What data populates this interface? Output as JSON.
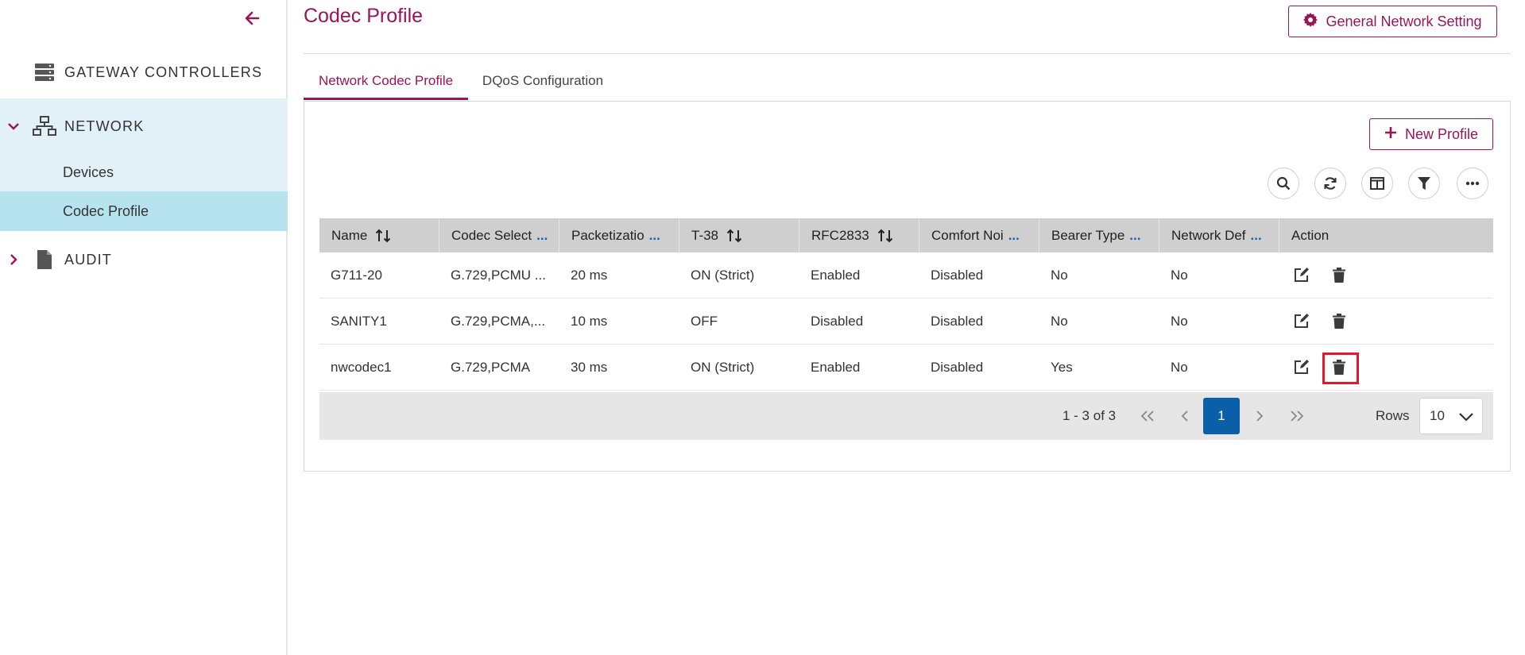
{
  "sidebar": {
    "collapse_icon": "arrow-left-icon",
    "items": [
      {
        "label": "GATEWAY CONTROLLERS",
        "icon": "server-icon"
      },
      {
        "label": "NETWORK",
        "icon": "network-icon",
        "expanded": true
      },
      {
        "label": "Devices"
      },
      {
        "label": "Codec Profile",
        "selected": true
      },
      {
        "label": "AUDIT",
        "icon": "document-icon",
        "expanded": false
      }
    ]
  },
  "header": {
    "title": "Codec Profile",
    "settings_button": "General Network Setting"
  },
  "tabs": [
    {
      "label": "Network Codec Profile",
      "active": true
    },
    {
      "label": "DQoS Configuration",
      "active": false
    }
  ],
  "toolbar": {
    "new_button": "New Profile",
    "icons": [
      "search-icon",
      "refresh-icon",
      "columns-icon",
      "filter-icon",
      "more-icon"
    ]
  },
  "table": {
    "columns": [
      {
        "label": "Name",
        "sortable": true
      },
      {
        "label": "Codec Select",
        "truncated": true
      },
      {
        "label": "Packetizatio",
        "truncated": true
      },
      {
        "label": "T-38",
        "sortable": true
      },
      {
        "label": "RFC2833",
        "sortable": true
      },
      {
        "label": "Comfort Noi",
        "truncated": true
      },
      {
        "label": "Bearer Type",
        "truncated": true
      },
      {
        "label": "Network Def",
        "truncated": true
      },
      {
        "label": "Action"
      }
    ],
    "more_marker": "...",
    "rows": [
      [
        "G711-20",
        "G.729,PCMU ...",
        "20 ms",
        "ON (Strict)",
        "Enabled",
        "Disabled",
        "No",
        "No"
      ],
      [
        "SANITY1",
        "G.729,PCMA,...",
        "10 ms",
        "OFF",
        "Disabled",
        "Disabled",
        "No",
        "No"
      ],
      [
        "nwcodec1",
        "G.729,PCMA",
        "30 ms",
        "ON (Strict)",
        "Enabled",
        "Disabled",
        "Yes",
        "No"
      ]
    ]
  },
  "pagination": {
    "range_text": "1 - 3 of 3",
    "current_page": "1",
    "rows_label": "Rows",
    "rows_value": "10"
  },
  "colors": {
    "accent": "#9c1458",
    "selected_nav": "#b7e3ef",
    "expanded_nav": "#e1f1f7",
    "current_page": "#0b5ea8",
    "highlight": "#e0192e"
  }
}
